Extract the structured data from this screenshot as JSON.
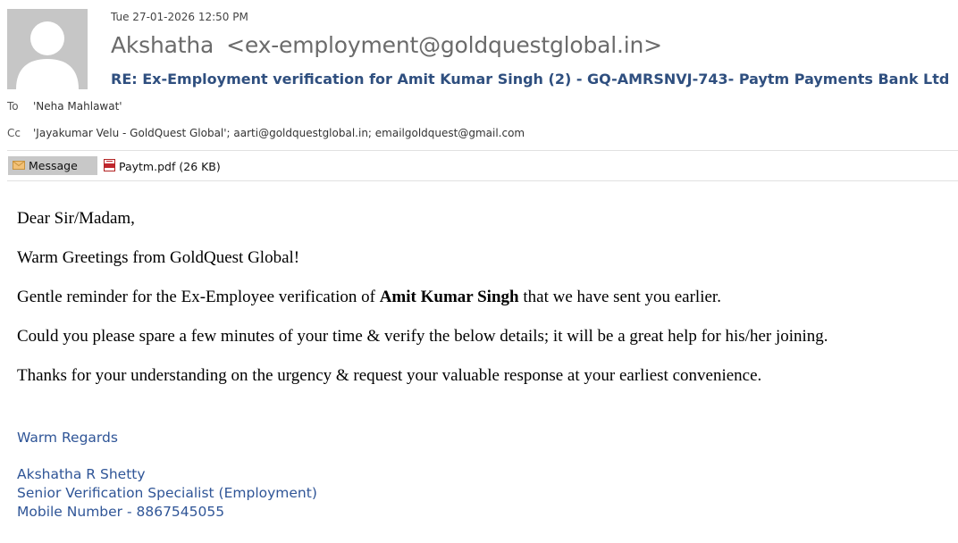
{
  "header": {
    "date": "Tue 27-01-2026 12:50 PM",
    "sender_name": "Akshatha",
    "sender_email": "<ex-employment@goldquestglobal.in>",
    "subject": "RE: Ex-Employment verification for Amit Kumar Singh (2) - GQ-AMRSNVJ-743- Paytm Payments Bank Ltd",
    "to_label": "To",
    "to_value": "'Neha Mahlawat'",
    "cc_label": "Cc",
    "cc_value": "'Jayakumar Velu - GoldQuest Global'; aarti@goldquestglobal.in; emailgoldquest@gmail.com"
  },
  "tabs": {
    "message_label": "Message",
    "message_icon": "envelope-icon",
    "attachment_name": "Paytm.pdf",
    "attachment_size": "(26 KB)",
    "attachment_icon": "pdf-icon"
  },
  "body": {
    "greeting": "Dear Sir/Madam,",
    "line1": "Warm Greetings from GoldQuest Global!",
    "line2_prefix": "Gentle reminder for the Ex-Employee verification of ",
    "line2_name": "Amit Kumar Singh",
    "line2_suffix": " that we have sent you earlier.",
    "line3": "Could you please spare a few minutes of your time & verify the below details; it will be a great help for his/her joining.",
    "line4": "Thanks for your understanding on the urgency & request your valuable response at your earliest convenience."
  },
  "signature": {
    "regards": "Warm Regards",
    "name": "Akshatha R Shetty",
    "title": "Senior Verification Specialist (Employment)",
    "mobile": "Mobile Number - 8867545055"
  },
  "colors": {
    "subject": "#2f4f7f",
    "signature": "#2f5597",
    "avatar_bg": "#c6c6c6"
  }
}
